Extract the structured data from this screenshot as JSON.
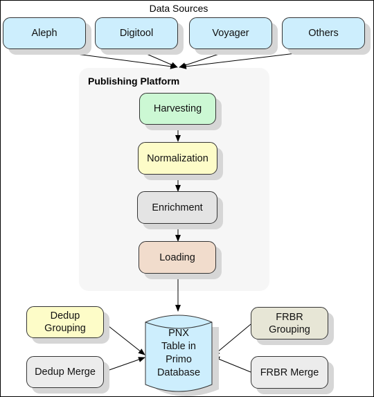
{
  "diagram": {
    "sources_title": "Data Sources",
    "sources": [
      {
        "label": "Aleph"
      },
      {
        "label": "Digitool"
      },
      {
        "label": "Voyager"
      },
      {
        "label": "Others"
      }
    ],
    "platform": {
      "title": "Publishing Platform",
      "steps": [
        {
          "label": "Harvesting",
          "color": "#ccf8d4"
        },
        {
          "label": "Normalization",
          "color": "#fdfcc8"
        },
        {
          "label": "Enrichment",
          "color": "#e4e4e4"
        },
        {
          "label": "Loading",
          "color": "#f1dccc"
        }
      ]
    },
    "database": {
      "lines": [
        "PNX",
        "Table in",
        "Primo",
        "Database"
      ],
      "color": "#cdeefd"
    },
    "left_inputs": [
      {
        "lines": [
          "Dedup",
          "Grouping"
        ],
        "color": "#fdfcc8"
      },
      {
        "lines": [
          "Dedup Merge"
        ],
        "color": "#ececec"
      }
    ],
    "right_inputs": [
      {
        "lines": [
          "FRBR",
          "Grouping"
        ],
        "color": "#e7e6d6"
      },
      {
        "lines": [
          "FRBR Merge"
        ],
        "color": "#ececec"
      }
    ],
    "source_color": "#cdeefd"
  }
}
